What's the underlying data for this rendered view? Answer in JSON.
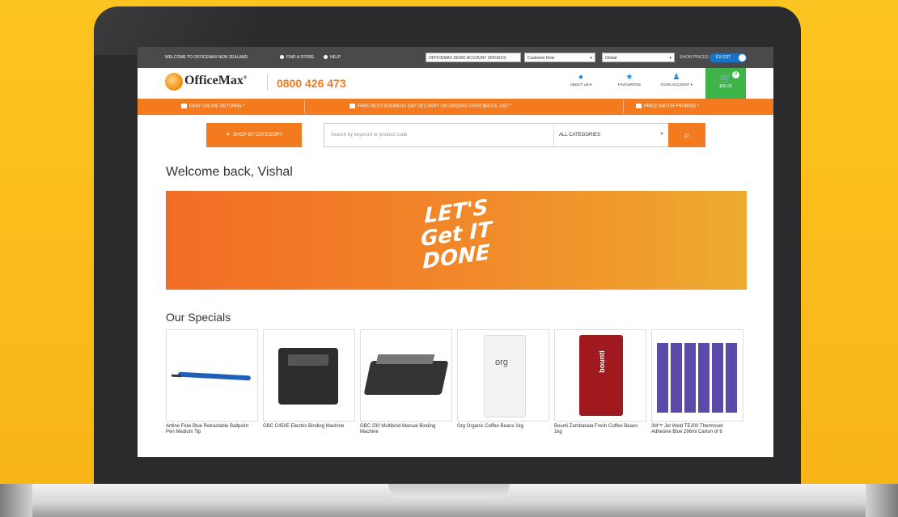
{
  "topbar": {
    "welcome": "WELCOME TO OFFICEMAX NEW ZEALAND",
    "find_store": "FIND A STORE",
    "help": "HELP",
    "account_select": "OFFICEMAX DEMO ACCOUNT (9001610)",
    "role_select": "Customer Role",
    "global_select": "Global",
    "show_prices": "SHOW PRICES",
    "toggle_label": "EX GST"
  },
  "header": {
    "logo": "OfficeMax",
    "logo_tm": "®",
    "phone": "0800 426 473",
    "about": "ABOUT US",
    "favourites": "FAVOURITES",
    "account": "YOUR ACCOUNT",
    "cart_count": "0",
    "cart_total": "$00.00"
  },
  "promo": {
    "returns": "EASY ONLINE RETURNS *",
    "delivery": "FREE NEXT BUSINESS DAY DELIVERY ON ORDERS OVER $50 EX. GST *",
    "price_match": "PRICE MATCH PROMISE *"
  },
  "search": {
    "shop_by_category": "SHOP BY CATEGORY",
    "placeholder": "Search by keyword or product code",
    "category": "ALL CATEGORIES"
  },
  "welcome": "Welcome back, Vishal",
  "banner": {
    "line1": "LET'S",
    "line2": "Get IT",
    "line3": "DONE"
  },
  "specials_title": "Our Specials",
  "products": [
    {
      "name": "Artline Flow Blue Retractable Ballpoint Pen Medium Tip"
    },
    {
      "name": "GBC C450E Electric Binding Machine"
    },
    {
      "name": "GBC 230 Multibind Manual Binding Machine"
    },
    {
      "name": "Org Organic Coffee Beans 1kg",
      "brand": "org"
    },
    {
      "name": "Bounti Zambakala Fresh Coffee Beans 1kg",
      "brand": "bounti"
    },
    {
      "name": "3M™ Jet Weld TE200 Thermoset Adhesive Blue 296ml Carton of 6"
    }
  ],
  "colors": {
    "accent": "#f47a20",
    "cart": "#3db34a",
    "topbar": "#4a4a4a"
  }
}
